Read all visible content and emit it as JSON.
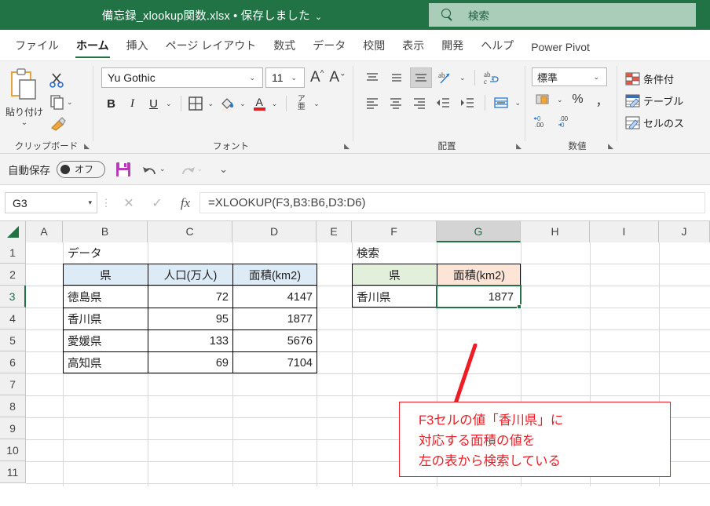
{
  "titlebar": {
    "document_title": "備忘録_xlookup関数.xlsx • 保存しました",
    "title_chevron": "⌄",
    "search_placeholder": "検索",
    "search_icon": "search-icon",
    "bar_color": "#217346",
    "search_bg": "#a9cdb8"
  },
  "ribbon_tabs": [
    {
      "label": "ファイル",
      "active": false
    },
    {
      "label": "ホーム",
      "active": true
    },
    {
      "label": "挿入",
      "active": false
    },
    {
      "label": "ページ レイアウト",
      "active": false
    },
    {
      "label": "数式",
      "active": false
    },
    {
      "label": "データ",
      "active": false
    },
    {
      "label": "校閲",
      "active": false
    },
    {
      "label": "表示",
      "active": false
    },
    {
      "label": "開発",
      "active": false
    },
    {
      "label": "ヘルプ",
      "active": false
    },
    {
      "label": "Power Pivot",
      "active": false
    }
  ],
  "ribbon": {
    "clipboard": {
      "group_label": "クリップボード",
      "paste_label": "貼り付け",
      "paste_chevron": "⌄",
      "cut_icon": "scissors-icon",
      "copy_icon": "copy-icon",
      "format_painter_icon": "format-painter-icon",
      "dialog_launcher": "⌐"
    },
    "font": {
      "group_label": "フォント",
      "font_name": "Yu Gothic",
      "font_size": "11",
      "grow_font": "A",
      "shrink_font": "A",
      "bold": "B",
      "italic": "I",
      "underline": "U",
      "border_icon": "borders-icon",
      "fill_icon": "fill-color-icon",
      "font_color": "A",
      "phonetic": "ア亜",
      "dropdown_caret": "⌄"
    },
    "alignment": {
      "group_label": "配置",
      "top_align_icon": "align-top-icon",
      "middle_align_icon": "align-middle-icon",
      "bottom_align_icon": "align-bottom-icon",
      "orientation_icon": "text-orientation-icon",
      "wrap_text_icon": "wrap-text-icon",
      "left_align_icon": "align-left-icon",
      "center_align_icon": "align-center-icon",
      "right_align_icon": "align-right-icon",
      "decrease_indent_icon": "decrease-indent-icon",
      "increase_indent_icon": "increase-indent-icon",
      "merge_icon": "merge-cells-icon"
    },
    "number": {
      "group_label": "数値",
      "format": "標準",
      "currency_icon": "currency-icon",
      "percent": "%",
      "comma": "，",
      "increase_decimal_icon": "increase-decimal-icon",
      "decrease_decimal_icon": "decrease-decimal-icon"
    },
    "styles": {
      "conditional_formatting": "条件付",
      "format_as_table": "テーブル",
      "cell_styles": "セルのス"
    }
  },
  "quick_access": {
    "autosave_label": "自動保存",
    "autosave_state": "オフ",
    "save_icon": "save-icon",
    "undo_icon": "undo-icon",
    "redo_icon": "redo-icon",
    "customize_icon": "customize-toolbar-icon"
  },
  "formula_bar": {
    "name_box": "G3",
    "cancel_icon": "cancel-icon",
    "enter_icon": "enter-icon",
    "function_icon": "fx",
    "formula": "=XLOOKUP(F3,B3:B6,D3:D6)"
  },
  "grid": {
    "columns": [
      "A",
      "B",
      "C",
      "D",
      "E",
      "F",
      "G",
      "H",
      "I",
      "J"
    ],
    "selected_column": "G",
    "rows": [
      "1",
      "2",
      "3",
      "4",
      "5",
      "6",
      "7",
      "8",
      "9",
      "10",
      "11"
    ],
    "selected_row": "3",
    "cells": {
      "B1": "データ",
      "F1": "検索",
      "B2": "県",
      "C2": "人口(万人)",
      "D2": "面積(km2)",
      "B3": "徳島県",
      "C3": "72",
      "D3": "4147",
      "B4": "香川県",
      "C4": "95",
      "D4": "1877",
      "B5": "愛媛県",
      "C5": "133",
      "D5": "5676",
      "B6": "高知県",
      "C6": "69",
      "D6": "7104",
      "F2": "県",
      "G2": "面積(km2)",
      "F3": "香川県",
      "G3": "1877"
    },
    "colors": {
      "data_header_fill": "#ddebf7",
      "lookup_key_fill": "#e2efda",
      "lookup_result_fill": "#fce4d6",
      "selection_border": "#217346"
    }
  },
  "annotation": {
    "line1": "F3セルの値「香川県」に",
    "line2": "対応する面積の値を",
    "line3": "左の表から検索している",
    "color": "#ee1c25"
  }
}
